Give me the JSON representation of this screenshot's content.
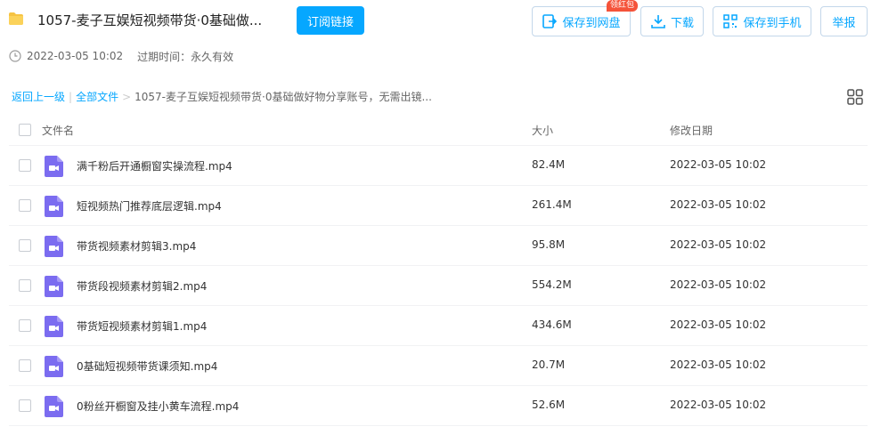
{
  "header": {
    "title": "1057-麦子互娱短视频带货·0基础做...",
    "subscribe_label": "订阅链接",
    "badge": "领红包",
    "buttons": {
      "save_cloud": "保存到网盘",
      "download": "下载",
      "save_phone": "保存到手机",
      "report": "举报"
    }
  },
  "meta": {
    "created": "2022-03-05 10:02",
    "expire": "过期时间：永久有效"
  },
  "breadcrumb": {
    "back": "返回上一级",
    "all_files": "全部文件",
    "current": "1057-麦子互娱短视频带货·0基础做好物分享账号，无需出镜..."
  },
  "table": {
    "headers": {
      "name": "文件名",
      "size": "大小",
      "date": "修改日期"
    },
    "rows": [
      {
        "name": "满千粉后开通橱窗实操流程.mp4",
        "size": "82.4M",
        "date": "2022-03-05 10:02"
      },
      {
        "name": "短视频热门推荐底层逻辑.mp4",
        "size": "261.4M",
        "date": "2022-03-05 10:02"
      },
      {
        "name": "带货视频素材剪辑3.mp4",
        "size": "95.8M",
        "date": "2022-03-05 10:02"
      },
      {
        "name": "带货段视频素材剪辑2.mp4",
        "size": "554.2M",
        "date": "2022-03-05 10:02"
      },
      {
        "name": "带货短视频素材剪辑1.mp4",
        "size": "434.6M",
        "date": "2022-03-05 10:02"
      },
      {
        "name": "0基础短视频带货课须知.mp4",
        "size": "20.7M",
        "date": "2022-03-05 10:02"
      },
      {
        "name": "0粉丝开橱窗及挂小黄车流程.mp4",
        "size": "52.6M",
        "date": "2022-03-05 10:02"
      }
    ]
  },
  "colors": {
    "accent": "#06a7ff",
    "badge": "#f5533a",
    "video_icon": "#7b6cf0",
    "folder": "#f6c343"
  }
}
